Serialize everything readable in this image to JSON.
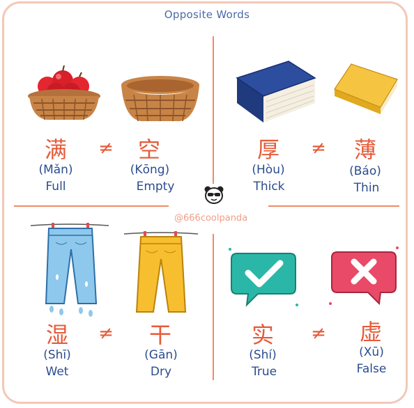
{
  "title": "Opposite Words",
  "credit": "@666coolpanda",
  "pairs": [
    {
      "left": {
        "hanzi": "满",
        "pinyin": "(Mǎn)",
        "english": "Full",
        "image": "basket-with-apples"
      },
      "right": {
        "hanzi": "空",
        "pinyin": "(Kōng)",
        "english": "Empty",
        "image": "empty-basket"
      }
    },
    {
      "left": {
        "hanzi": "厚",
        "pinyin": "(Hòu)",
        "english": "Thick",
        "image": "thick-blue-book"
      },
      "right": {
        "hanzi": "薄",
        "pinyin": "(Báo)",
        "english": "Thin",
        "image": "thin-yellow-book"
      }
    },
    {
      "left": {
        "hanzi": "湿",
        "pinyin": "(Shī)",
        "english": "Wet",
        "image": "wet-blue-jeans"
      },
      "right": {
        "hanzi": "干",
        "pinyin": "(Gān)",
        "english": "Dry",
        "image": "dry-yellow-pants"
      }
    },
    {
      "left": {
        "hanzi": "实",
        "pinyin": "(Shí)",
        "english": "True",
        "image": "check-icon"
      },
      "right": {
        "hanzi": "虚",
        "pinyin": "(Xū)",
        "english": "False",
        "image": "cross-icon"
      }
    }
  ],
  "not_equal_symbol": "≠",
  "colors": {
    "border": "#f2c8b8",
    "accent": "#e65b3a",
    "text": "#2b4c8e",
    "check_bg": "#2bb7a8",
    "cross_bg": "#e84a67"
  }
}
